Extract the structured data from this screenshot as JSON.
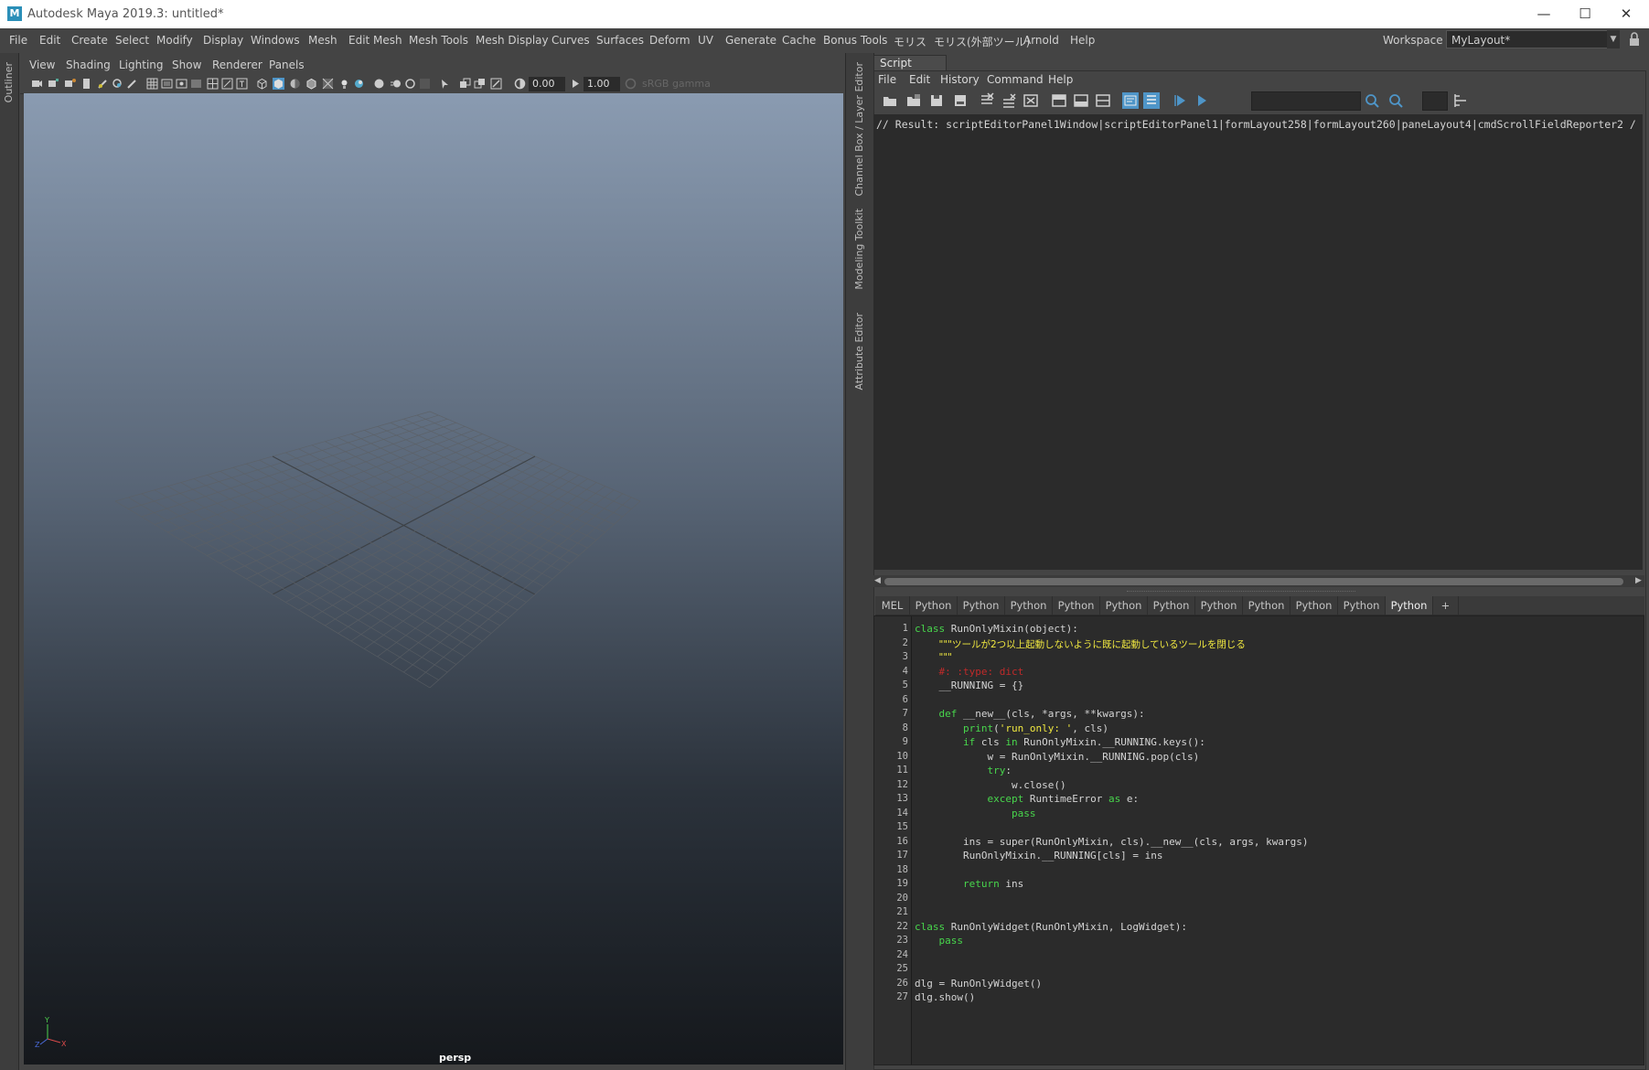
{
  "window": {
    "title": "Autodesk Maya 2019.3: untitled*",
    "logo": "M",
    "minimize": "—",
    "maximize": "☐",
    "close": "✕"
  },
  "menubar": {
    "items": [
      "File",
      "Edit",
      "Create",
      "Select",
      "Modify",
      "Display",
      "Windows",
      "Mesh",
      "Edit Mesh",
      "Mesh Tools",
      "Mesh Display",
      "Curves",
      "Surfaces",
      "Deform",
      "UV",
      "Generate",
      "Cache",
      "Bonus Tools",
      "モリス",
      "モリス(外部ツール)",
      "Arnold",
      "Help"
    ],
    "workspace_label": "Workspace :",
    "workspace_value": "MyLayout*"
  },
  "side_tabs": {
    "outliner": "Outliner",
    "channel_box": "Channel Box / Layer Editor",
    "modeling_toolkit": "Modeling Toolkit",
    "attribute_editor": "Attribute Editor"
  },
  "viewport": {
    "menu": [
      "View",
      "Shading",
      "Lighting",
      "Show",
      "Renderer",
      "Panels"
    ],
    "exposure": "0.00",
    "gamma": "1.00",
    "color_space": "sRGB gamma",
    "camera": "persp",
    "axis_y": "Y",
    "axis_x": "X",
    "axis_z": "Z"
  },
  "script_editor": {
    "title": "Script Editor",
    "menu": [
      "File",
      "Edit",
      "History",
      "Command",
      "Help"
    ],
    "history_line": "// Result: scriptEditorPanel1Window|scriptEditorPanel1|formLayout258|formLayout260|paneLayout4|cmdScrollFieldReporter2 /",
    "tabs": [
      "MEL",
      "Python",
      "Python",
      "Python",
      "Python",
      "Python",
      "Python",
      "Python",
      "Python",
      "Python",
      "Python",
      "Python",
      "+"
    ],
    "active_tab": 11,
    "code_lines": [
      {
        "n": "1",
        "t": "class RunOnlyMixin(object):"
      },
      {
        "n": "2",
        "t": "    \"\"\"ツールが2つ以上起動しないように既に起動しているツールを閉じる"
      },
      {
        "n": "3",
        "t": "    \"\"\""
      },
      {
        "n": "4",
        "t": "    #: :type: dict"
      },
      {
        "n": "5",
        "t": "    __RUNNING = {}"
      },
      {
        "n": "6",
        "t": ""
      },
      {
        "n": "7",
        "t": "    def __new__(cls, *args, **kwargs):"
      },
      {
        "n": "8",
        "t": "        print('run_only: ', cls)"
      },
      {
        "n": "9",
        "t": "        if cls in RunOnlyMixin.__RUNNING.keys():"
      },
      {
        "n": "10",
        "t": "            w = RunOnlyMixin.__RUNNING.pop(cls)"
      },
      {
        "n": "11",
        "t": "            try:"
      },
      {
        "n": "12",
        "t": "                w.close()"
      },
      {
        "n": "13",
        "t": "            except RuntimeError as e:"
      },
      {
        "n": "14",
        "t": "                pass"
      },
      {
        "n": "15",
        "t": ""
      },
      {
        "n": "16",
        "t": "        ins = super(RunOnlyMixin, cls).__new__(cls, args, kwargs)"
      },
      {
        "n": "17",
        "t": "        RunOnlyMixin.__RUNNING[cls] = ins"
      },
      {
        "n": "18",
        "t": ""
      },
      {
        "n": "19",
        "t": "        return ins"
      },
      {
        "n": "20",
        "t": ""
      },
      {
        "n": "21",
        "t": ""
      },
      {
        "n": "22",
        "t": "class RunOnlyWidget(RunOnlyMixin, LogWidget):"
      },
      {
        "n": "23",
        "t": "    pass"
      },
      {
        "n": "24",
        "t": ""
      },
      {
        "n": "25",
        "t": ""
      },
      {
        "n": "26",
        "t": "dlg = RunOnlyWidget()"
      },
      {
        "n": "27",
        "t": "dlg.show()"
      }
    ]
  },
  "colors": {
    "keyword": "#48d64c",
    "string": "#f0e840",
    "comment": "#c02a2a",
    "accent": "#4e95c8"
  }
}
